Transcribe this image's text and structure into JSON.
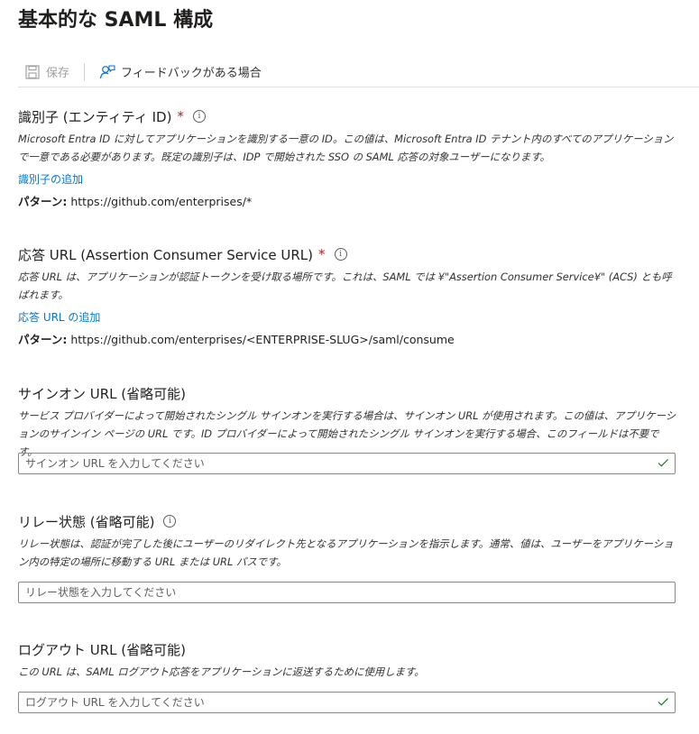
{
  "page": {
    "title": "基本的な SAML 構成"
  },
  "toolbar": {
    "save_label": "保存",
    "feedback_label": "フィードバックがある場合"
  },
  "identifier": {
    "label": "識別子 (エンティティ ID)",
    "required_mark": "*",
    "description": "Microsoft Entra ID に対してアプリケーションを識別する一意の ID。この値は、Microsoft Entra ID テナント内のすべてのアプリケーションで一意である必要があります。既定の識別子は、IDP で開始された SSO の SAML 応答の対象ユーザーになります。",
    "add_link": "識別子の追加",
    "pattern_label": "パターン:",
    "pattern_value": "https://github.com/enterprises/*"
  },
  "reply_url": {
    "label": "応答 URL (Assertion Consumer Service URL)",
    "required_mark": "*",
    "description": "応答 URL は、アプリケーションが認証トークンを受け取る場所です。これは、SAML では ¥\"Assertion Consumer Service¥\" (ACS) とも呼ばれます。",
    "add_link": "応答 URL の追加",
    "pattern_label": "パターン:",
    "pattern_value": "https://github.com/enterprises/<ENTERPRISE-SLUG>/saml/consume"
  },
  "signon_url": {
    "label": "サインオン URL (省略可能)",
    "description": "サービス プロバイダーによって開始されたシングル サインオンを実行する場合は、サインオン URL が使用されます。この値は、アプリケーションのサインイン ページの URL です。ID プロバイダーによって開始されたシングル サインオンを実行する場合、このフィールドは不要です。",
    "placeholder": "サインオン URL を入力してください"
  },
  "relay_state": {
    "label": "リレー状態 (省略可能)",
    "description": "リレー状態は、認証が完了した後にユーザーのリダイレクト先となるアプリケーションを指示します。通常、値は、ユーザーをアプリケーション内の特定の場所に移動する URL または URL パスです。",
    "placeholder": "リレー状態を入力してください"
  },
  "logout_url": {
    "label": "ログアウト URL (省略可能)",
    "description": "この URL は、SAML ログアウト応答をアプリケーションに返送するために使用します。",
    "placeholder": "ログアウト URL を入力してください"
  },
  "icons": {
    "save": "save-icon",
    "feedback": "feedback-person-icon",
    "info": "info-icon",
    "check": "checkmark-icon"
  },
  "colors": {
    "link": "#0078d4",
    "required": "#a4262c",
    "check": "#107c10"
  }
}
